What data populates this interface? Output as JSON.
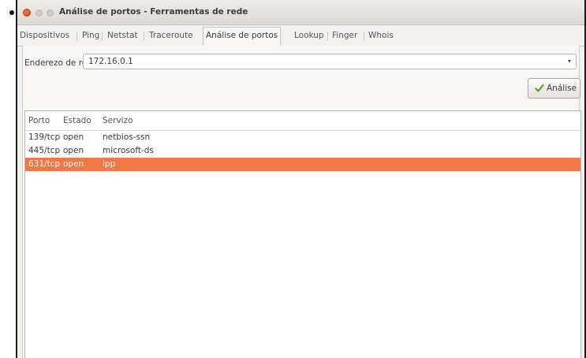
{
  "window": {
    "title": "Análise de portos - Ferramentas de rede"
  },
  "tabs": [
    {
      "label": "Dispositivos"
    },
    {
      "label": "Ping"
    },
    {
      "label": "Netstat"
    },
    {
      "label": "Traceroute"
    },
    {
      "label": "Análise de portos",
      "active": true
    },
    {
      "label": "Lookup"
    },
    {
      "label": "Finger"
    },
    {
      "label": "Whois"
    }
  ],
  "address": {
    "label": "Enderezo de rede:",
    "value": "172.16.0.1"
  },
  "analyse_button": {
    "label": "Análise",
    "icon": "check-icon"
  },
  "results": {
    "columns": [
      "Porto",
      "Estado",
      "Servizo"
    ],
    "rows": [
      {
        "port": "139/tcp",
        "state": "open",
        "service": "netbios-ssn"
      },
      {
        "port": "445/tcp",
        "state": "open",
        "service": "microsoft-ds"
      },
      {
        "port": "631/tcp",
        "state": "open",
        "service": "ipp",
        "selected": true
      }
    ]
  },
  "colors": {
    "selection": "#f07746",
    "close_button": "#e05a2b",
    "check_icon": "#5a9a2e"
  }
}
